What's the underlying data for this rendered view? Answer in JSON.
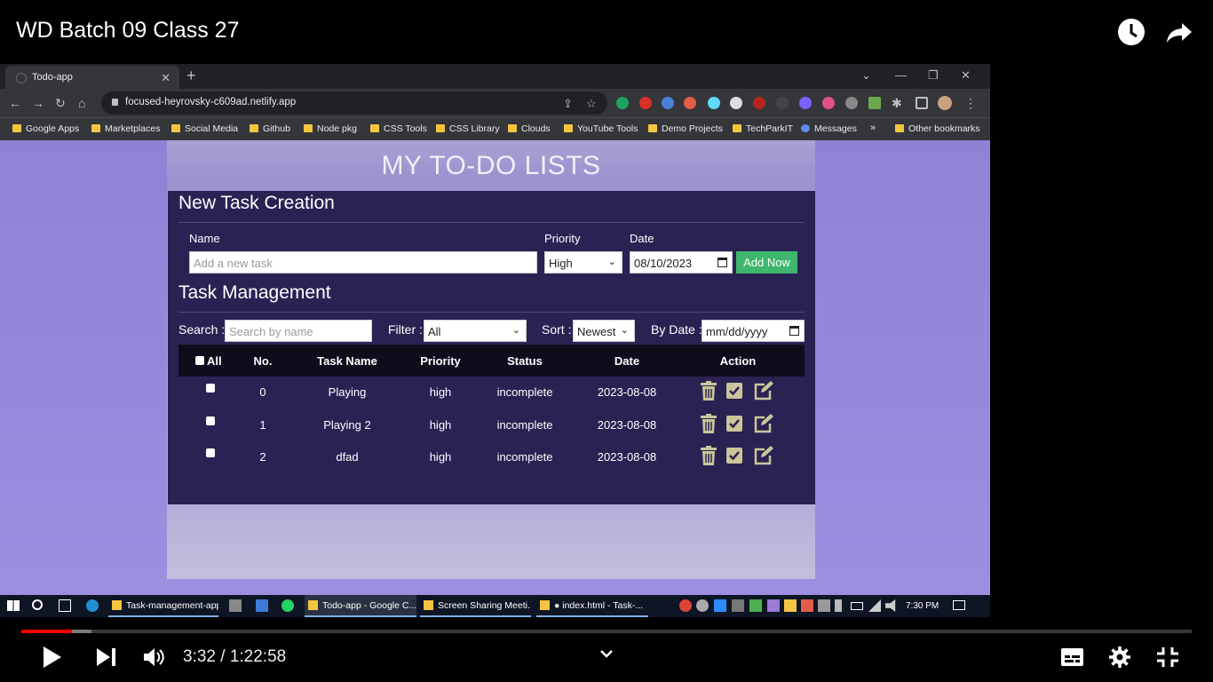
{
  "video": {
    "title": "WD Batch 09 Class 27",
    "time_display": "3:32 / 1:22:58",
    "progress_fraction": 0.043,
    "buffer_fraction": 0.06
  },
  "browser": {
    "tab_title": "Todo-app",
    "url": "focused-heyrovsky-c609ad.netlify.app",
    "bookmarks": [
      "Google Apps",
      "Marketplaces",
      "Social Media",
      "Github",
      "Node pkg",
      "CSS Tools",
      "CSS Library",
      "Clouds",
      "YouTube Tools",
      "Demo Projects",
      "TechParkIT",
      "Messages",
      "»",
      "Other bookmarks"
    ]
  },
  "app": {
    "title": "MY TO-DO LISTS",
    "create": {
      "heading": "New Task Creation",
      "name_label": "Name",
      "name_placeholder": "Add a new task",
      "priority_label": "Priority",
      "priority_value": "High",
      "date_label": "Date",
      "date_value": "08/10/2023",
      "add_button": "Add Now"
    },
    "manage": {
      "heading": "Task Management",
      "search_label": "Search :",
      "search_placeholder": "Search by name",
      "filter_label": "Filter :",
      "filter_value": "All",
      "sort_label": "Sort :",
      "sort_value": "Newest",
      "bydate_label": "By Date :",
      "bydate_placeholder": "mm/dd/yyyy"
    },
    "table": {
      "headers": [
        "All",
        "No.",
        "Task Name",
        "Priority",
        "Status",
        "Date",
        "Action"
      ],
      "rows": [
        {
          "no": "0",
          "name": "Playing",
          "priority": "high",
          "status": "incomplete",
          "date": "2023-08-08"
        },
        {
          "no": "1",
          "name": "Playing 2",
          "priority": "high",
          "status": "incomplete",
          "date": "2023-08-08"
        },
        {
          "no": "2",
          "name": "dfad",
          "priority": "high",
          "status": "incomplete",
          "date": "2023-08-08"
        }
      ]
    }
  },
  "taskbar": {
    "apps": [
      "Task-management-app",
      "Todo-app - Google C...",
      "Screen Sharing Meeti...",
      "● index.html - Task-..."
    ],
    "time": "7:30 PM"
  },
  "colors": {
    "panel": "#2b2254",
    "add_button": "#3fb66d",
    "progress": "#ff0000",
    "icon": "#c9c69a"
  }
}
